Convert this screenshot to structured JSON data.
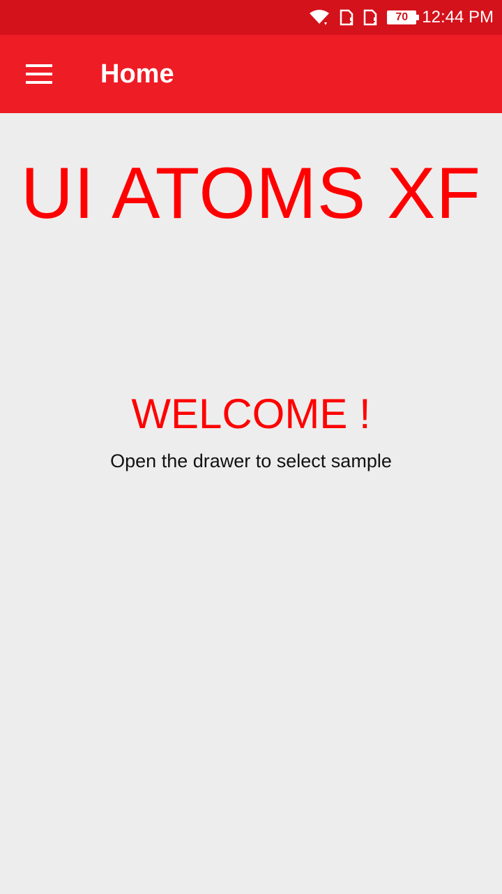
{
  "status_bar": {
    "battery_level": "70",
    "time": "12:44 PM",
    "icons": [
      "wifi-icon",
      "sim-card-1-icon",
      "sim-card-2-icon",
      "battery-icon"
    ]
  },
  "app_bar": {
    "title": "Home",
    "menu_icon": "hamburger-menu-icon",
    "background": "#ee1c25"
  },
  "main": {
    "brand_title": "UI ATOMS XF",
    "welcome_title": "WELCOME !",
    "welcome_subtitle": "Open the drawer to select sample"
  },
  "colors": {
    "status_bar": "#d3121b",
    "accent": "#ff0000",
    "page_background": "#eeeded"
  }
}
